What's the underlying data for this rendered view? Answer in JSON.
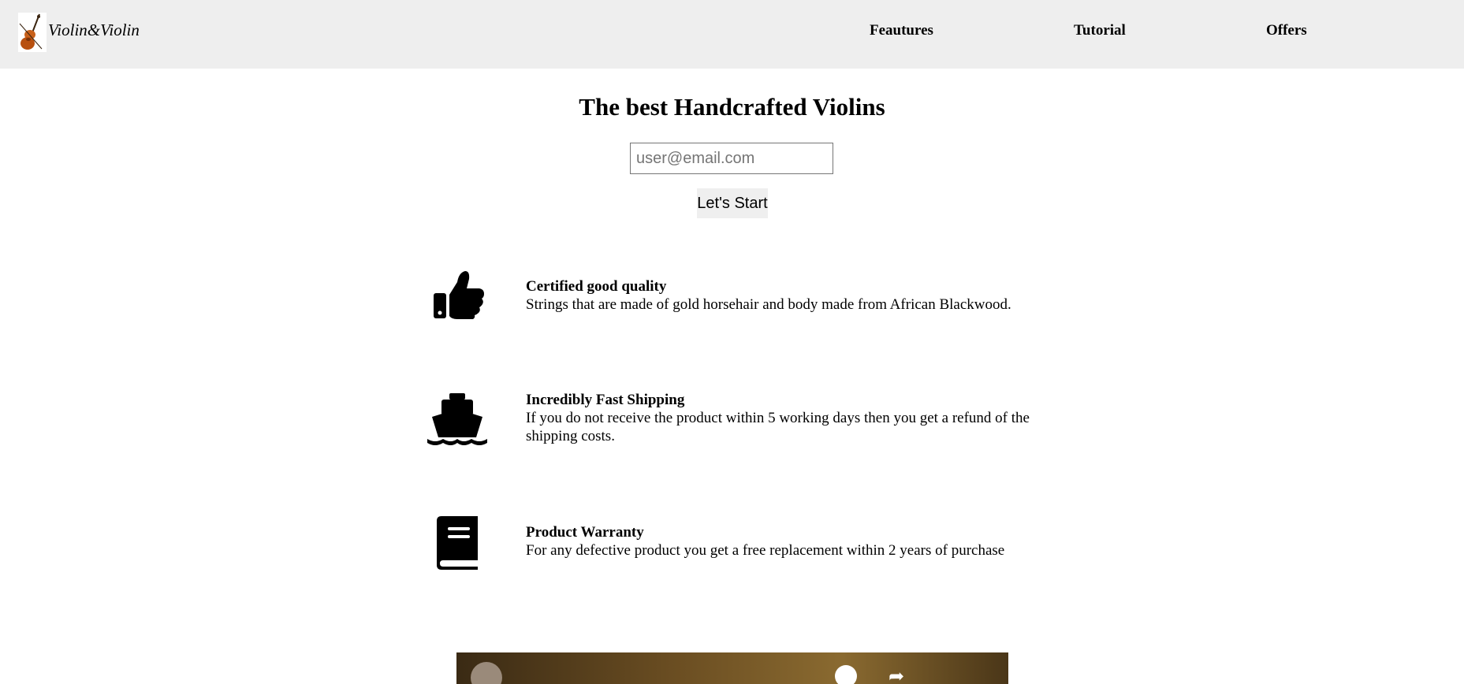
{
  "header": {
    "brand": "Violin&Violin",
    "logo_icon": "violin-icon",
    "nav": [
      {
        "label": "Feautures"
      },
      {
        "label": "Tutorial"
      },
      {
        "label": "Offers"
      }
    ]
  },
  "hero": {
    "title": "The best Handcrafted Violins",
    "email_placeholder": "user@email.com",
    "start_label": "Let's Start"
  },
  "features": [
    {
      "icon": "thumbs-up-icon",
      "title": "Certified good quality",
      "description": "Strings that are made of gold horsehair and body made from African Blackwood."
    },
    {
      "icon": "ship-icon",
      "title": "Incredibly Fast Shipping",
      "description": "If you do not receive the product within 5 working days then you get a refund of the shipping costs."
    },
    {
      "icon": "book-icon",
      "title": "Product Warranty",
      "description": "For any defective product you get a free replacement within 2 years of purchase"
    }
  ],
  "video": {
    "icons": [
      "channel-avatar",
      "info-icon",
      "share-icon"
    ]
  }
}
